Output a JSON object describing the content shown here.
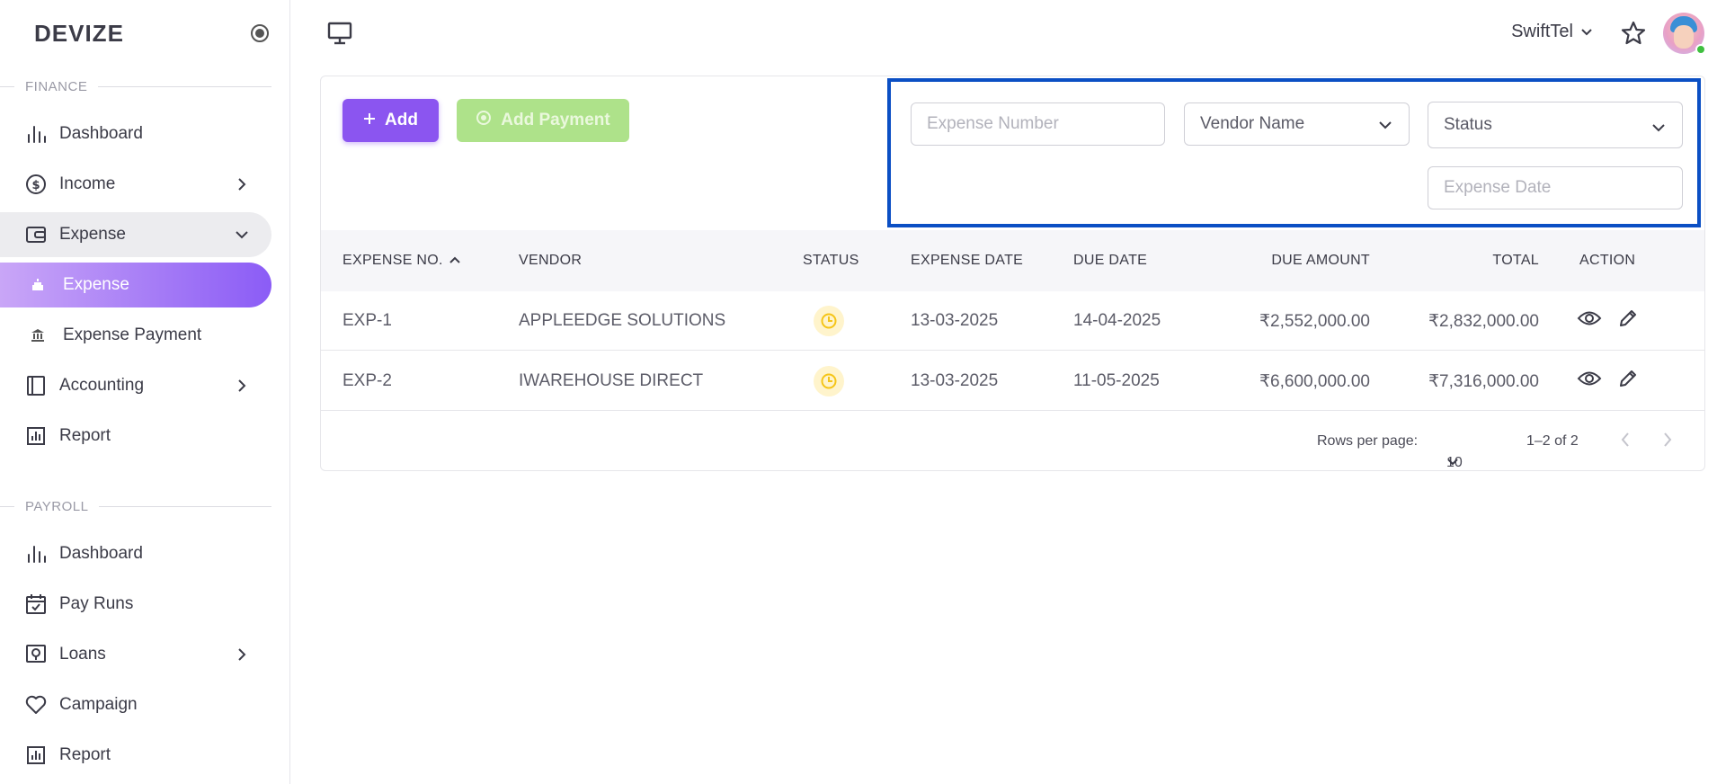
{
  "brand": "DEVIZE",
  "sidebar": {
    "finance_label": "FINANCE",
    "payroll_label": "PAYROLL",
    "finance_items": [
      {
        "label": "Dashboard"
      },
      {
        "label": "Income"
      },
      {
        "label": "Expense"
      },
      {
        "label": "Expense"
      },
      {
        "label": "Expense Payment"
      },
      {
        "label": "Accounting"
      },
      {
        "label": "Report"
      }
    ],
    "payroll_items": [
      {
        "label": "Dashboard"
      },
      {
        "label": "Pay Runs"
      },
      {
        "label": "Loans"
      },
      {
        "label": "Campaign"
      },
      {
        "label": "Report"
      }
    ]
  },
  "topbar": {
    "company": "SwiftTel"
  },
  "toolbar": {
    "add_label": "Add",
    "add_payment_label": "Add Payment"
  },
  "filters": {
    "expense_number_placeholder": "Expense Number",
    "vendor_name_placeholder": "Vendor Name",
    "status_placeholder": "Status",
    "expense_date_placeholder": "Expense Date"
  },
  "table": {
    "headers": [
      "EXPENSE NO.",
      "VENDOR",
      "STATUS",
      "EXPENSE DATE",
      "DUE DATE",
      "DUE AMOUNT",
      "TOTAL",
      "ACTION"
    ],
    "rows": [
      {
        "no": "EXP-1",
        "vendor": "APPLEEDGE SOLUTIONS",
        "expense_date": "13-03-2025",
        "due_date": "14-04-2025",
        "due_amount": "₹2,552,000.00",
        "total": "₹2,832,000.00"
      },
      {
        "no": "EXP-2",
        "vendor": "IWAREHOUSE DIRECT",
        "expense_date": "13-03-2025",
        "due_date": "11-05-2025",
        "due_amount": "₹6,600,000.00",
        "total": "₹7,316,000.00"
      }
    ]
  },
  "pagination": {
    "rows_per_page_label": "Rows per page:",
    "rows_per_page_value": "10",
    "range": "1–2 of 2"
  },
  "colors": {
    "accent": "#8b55f0",
    "add_payment": "#aee28a",
    "highlight_border": "#0b4fc4",
    "pending_status": "#f5c518"
  }
}
